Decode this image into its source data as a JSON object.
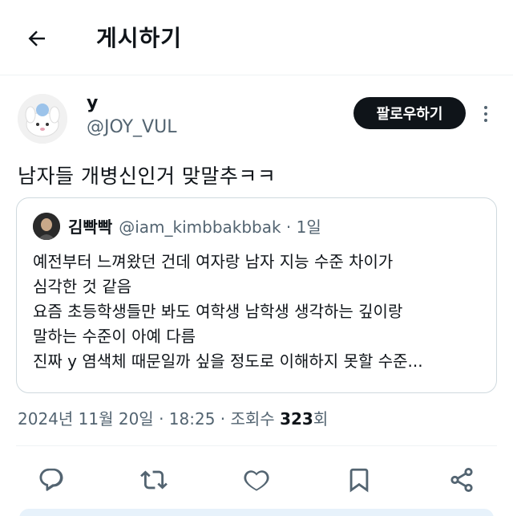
{
  "header": {
    "title": "게시하기"
  },
  "author": {
    "display_name": "y",
    "handle": "@JOY_VUL"
  },
  "follow_label": "팔로우하기",
  "tweet_text": "남자들 개병신인거 맞말추ㅋㅋ",
  "quote": {
    "name": "김빡빡",
    "handle_time": "@iam_kimbbakbbak · 1일",
    "lines": [
      "예전부터 느껴왔던 건데 여자랑 남자 지능 수준 차이가",
      "심각한 것 같음",
      "요즘 초등학생들만 봐도 여학생 남학생 생각하는 깊이랑",
      "말하는 수준이 아예 다름",
      "진짜 y 염색체 때문일까 싶을 정도로 이해하지 못할 수준..."
    ]
  },
  "meta": {
    "prefix": "2024년 11월 20일 · 18:25 · 조회수 ",
    "views": "323",
    "suffix": "회"
  },
  "icons": {
    "back": "back-arrow-icon",
    "reply": "reply-icon",
    "retweet": "retweet-icon",
    "like": "heart-icon",
    "bookmark": "bookmark-icon",
    "share": "share-icon"
  },
  "colors": {
    "text": "#0f1419",
    "secondary": "#536471",
    "border": "#cfd9de"
  }
}
